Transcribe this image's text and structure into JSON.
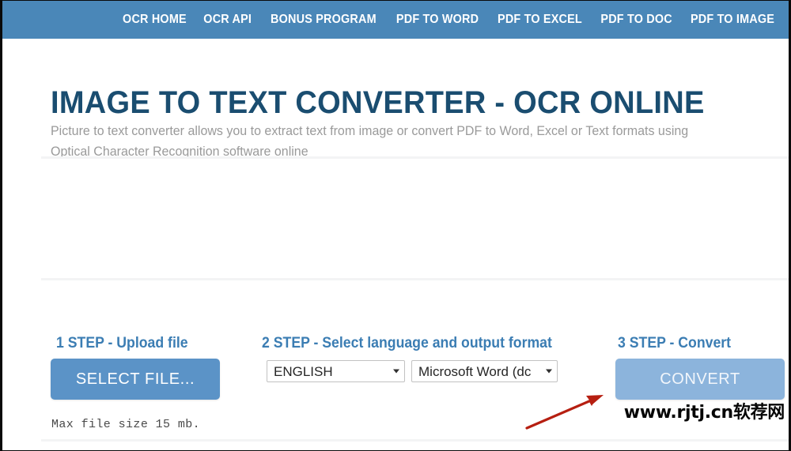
{
  "navbar": {
    "background_color": "#4a87b8",
    "items": [
      {
        "label": "OCR HOME",
        "name": "nav-ocr-home"
      },
      {
        "label": "OCR API",
        "name": "nav-ocr-api"
      },
      {
        "label": "BONUS PROGRAM",
        "name": "nav-bonus-program"
      },
      {
        "label": "PDF TO WORD",
        "name": "nav-pdf-to-word"
      },
      {
        "label": "PDF TO EXCEL",
        "name": "nav-pdf-to-excel"
      },
      {
        "label": "PDF TO DOC",
        "name": "nav-pdf-to-doc"
      },
      {
        "label": "PDF TO IMAGE",
        "name": "nav-pdf-to-image"
      }
    ]
  },
  "hero": {
    "title": "IMAGE TO TEXT CONVERTER - OCR ONLINE",
    "title_color": "#1a4d70",
    "subtitle": "Picture to text converter allows you to extract text from image or convert PDF to Word, Excel or Text formats using Optical Character Recognition software online",
    "subtitle_color": "#9a9a9a"
  },
  "steps": {
    "step1": {
      "heading": "1 STEP - Upload file",
      "button_label": "SELECT FILE...",
      "button_color": "#5b93c7",
      "note": "Max file size 15 mb."
    },
    "step2": {
      "heading": "2 STEP - Select language and output format",
      "language_select": {
        "value": "ENGLISH",
        "options": [
          "ENGLISH"
        ]
      },
      "format_select": {
        "value": "Microsoft Word (dc",
        "options": [
          "Microsoft Word (dc"
        ]
      }
    },
    "step3": {
      "heading": "3 STEP - Convert",
      "button_label": "CONVERT",
      "button_color": "#8cb4dc"
    },
    "heading_color": "#3b7db3"
  },
  "annotation": {
    "arrow_color": "#b61f11",
    "arrow_name": "red-pointer-arrow",
    "points_to": "CONVERT"
  },
  "watermark": {
    "text": "www.rjtj.cn软荐网"
  }
}
